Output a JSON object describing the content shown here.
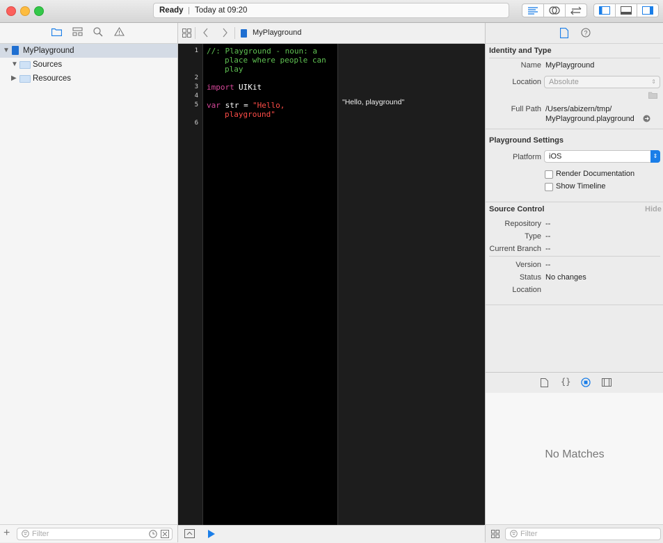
{
  "toolbar": {
    "status_ready": "Ready",
    "status_separator": "|",
    "status_time": "Today at 09:20"
  },
  "navigator": {
    "project": "MyPlayground",
    "items": [
      {
        "label": "Sources"
      },
      {
        "label": "Resources"
      }
    ],
    "filter_placeholder": "Filter"
  },
  "editor": {
    "breadcrumb": "MyPlayground",
    "line_numbers": [
      "1",
      "2",
      "3",
      "4",
      "5",
      "6"
    ],
    "code": {
      "line1_a": "//: Playground - noun: a",
      "line1_b": "place where people can",
      "line1_c": "play",
      "kw_import": "import",
      "module": "UIKit",
      "kw_var": "var",
      "var_decl": " str = ",
      "string_a": "\"Hello,",
      "string_b": "playground\""
    },
    "result": "\"Hello, playground\""
  },
  "inspector": {
    "identity_header": "Identity and Type",
    "name_label": "Name",
    "name_value": "MyPlayground",
    "location_label": "Location",
    "location_value": "Absolute",
    "fullpath_label": "Full Path",
    "fullpath_line1": "/Users/abizern/tmp/",
    "fullpath_line2": "MyPlayground.playground",
    "settings_header": "Playground Settings",
    "platform_label": "Platform",
    "platform_value": "iOS",
    "render_docs": "Render Documentation",
    "show_timeline": "Show Timeline",
    "source_control_header": "Source Control",
    "hide_label": "Hide",
    "repository_label": "Repository",
    "repository_value": "--",
    "type_label": "Type",
    "type_value": "--",
    "branch_label": "Current Branch",
    "branch_value": "--",
    "version_label": "Version",
    "version_value": "--",
    "status_label": "Status",
    "status_value": "No changes",
    "sc_location_label": "Location",
    "library_empty": "No Matches",
    "filter_placeholder": "Filter"
  },
  "colors": {
    "comment": "#5fc152",
    "keyword": "#d8479b",
    "string": "#ff4d48",
    "accent": "#1a7ee8"
  }
}
